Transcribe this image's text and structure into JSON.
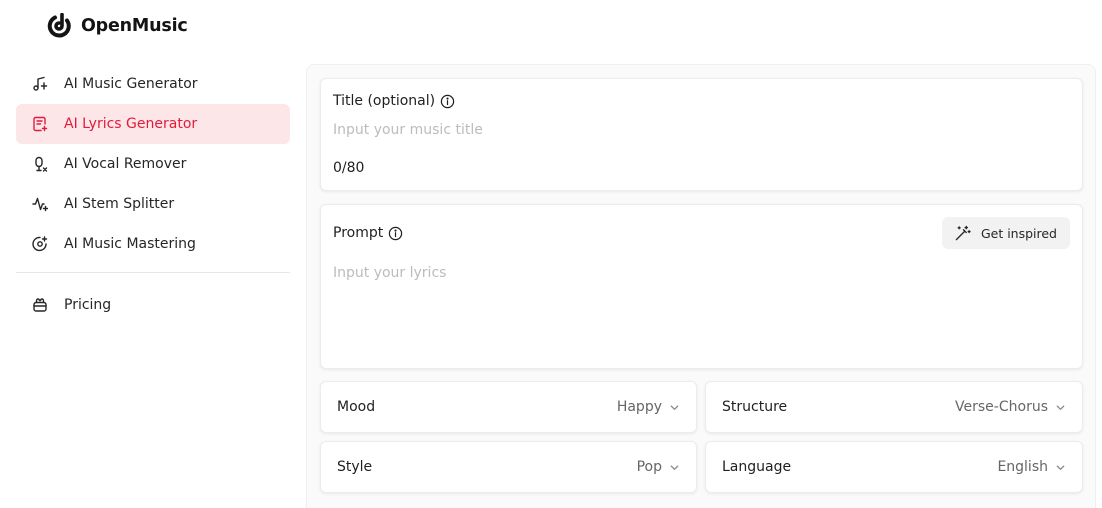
{
  "app": {
    "name": "OpenMusic",
    "accent_color": "#e31b3b",
    "active_bg_color": "#fde6e8"
  },
  "sidebar": {
    "items": [
      {
        "label": "AI Music Generator",
        "icon": "music-note-icon",
        "active": false
      },
      {
        "label": "AI Lyrics Generator",
        "icon": "lyrics-doc-icon",
        "active": true
      },
      {
        "label": "AI Vocal Remover",
        "icon": "microphone-icon",
        "active": false
      },
      {
        "label": "AI Stem Splitter",
        "icon": "waveform-icon",
        "active": false
      },
      {
        "label": "AI Music Mastering",
        "icon": "disc-sparkle-icon",
        "active": false
      }
    ],
    "pricing": {
      "label": "Pricing",
      "icon": "pricing-icon"
    }
  },
  "form": {
    "title": {
      "label": "Title (optional)",
      "placeholder": "Input your music title",
      "value": "",
      "counter": "0/80"
    },
    "prompt": {
      "label": "Prompt",
      "placeholder": "Input your lyrics",
      "value": "",
      "inspire_button": "Get inspired"
    },
    "selects": {
      "mood": {
        "label": "Mood",
        "value": "Happy"
      },
      "structure": {
        "label": "Structure",
        "value": "Verse-Chorus"
      },
      "style": {
        "label": "Style",
        "value": "Pop"
      },
      "language": {
        "label": "Language",
        "value": "English"
      }
    }
  }
}
